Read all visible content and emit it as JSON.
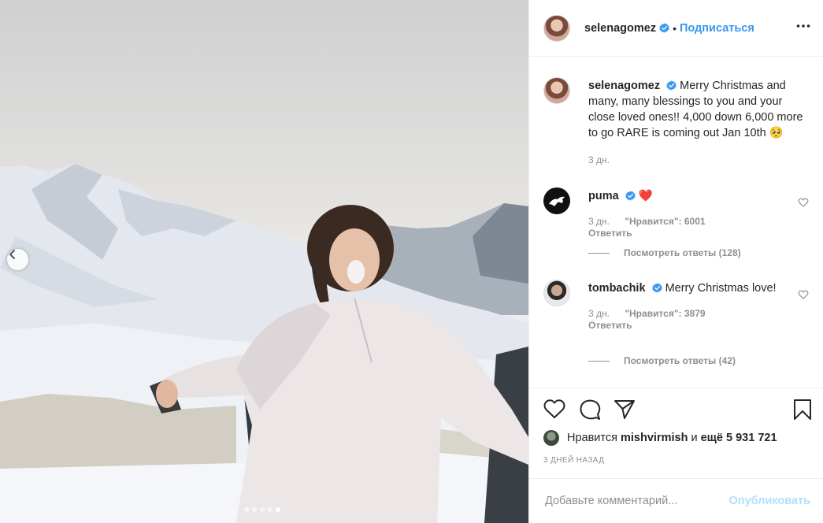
{
  "post": {
    "username": "selenagomez",
    "follow_label": "Подписаться",
    "separator": "•",
    "caption": "Merry Christmas and many, many blessings to you and your close loved ones!! 4,000 down 6,000 more to go RARE is coming out Jan 10th",
    "caption_emoji": "🥺",
    "caption_time": "3 дн."
  },
  "comments": [
    {
      "username": "puma",
      "text": "❤️",
      "time": "3 дн.",
      "likes": "\"Нравится\": 6001",
      "reply": "Ответить",
      "view_replies": "Посмотреть ответы (128)"
    },
    {
      "username": "tombachik",
      "text": "Merry Christmas love!",
      "time": "3 дн.",
      "likes": "\"Нравится\": 3879",
      "reply": "Ответить",
      "view_replies": "Посмотреть ответы (42)"
    }
  ],
  "likes_bar": {
    "prefix": "Нравится",
    "user": "mishvirmish",
    "conjunction": "и",
    "others": "ещё 5 931 721"
  },
  "timestamp": "3 ДНЕЙ НАЗАД",
  "comment_box": {
    "placeholder": "Добавьте комментарий...",
    "publish_label": "Опубликовать"
  },
  "carousel": {
    "slides": 5,
    "active_index": 4
  },
  "icons": [
    "chevron-left-icon",
    "verified-icon",
    "more-options-icon",
    "heart-icon",
    "comment-icon",
    "share-icon",
    "bookmark-icon"
  ],
  "colors": {
    "accent": "#3897f0",
    "verified": "#3897f0",
    "publish_disabled": "#b2dffc",
    "muted": "#8e8e8e",
    "puma_heart": "#e0142b"
  }
}
